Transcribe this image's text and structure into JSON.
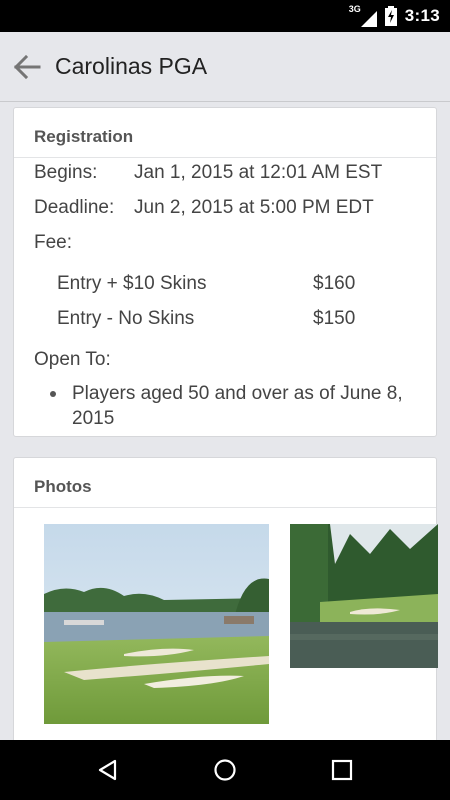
{
  "status_bar": {
    "network": "3G",
    "time": "3:13",
    "icons": [
      "signal-icon",
      "battery-charging-icon"
    ]
  },
  "app_bar": {
    "title": "Carolinas PGA",
    "back_icon": "arrow-back-icon"
  },
  "registration": {
    "header": "Registration",
    "begins_label": "Begins:",
    "begins_value": "Jan 1, 2015 at 12:01 AM EST",
    "deadline_label": "Deadline:",
    "deadline_value": "Jun 2, 2015 at 5:00 PM EDT",
    "fee_label": "Fee:",
    "fees": [
      {
        "name": "Entry + $10 Skins",
        "price": "$160"
      },
      {
        "name": "Entry - No Skins",
        "price": "$150"
      }
    ],
    "open_to_label": "Open To:",
    "eligibility": [
      "Players aged 50 and over as of June 8, 2015"
    ]
  },
  "photos": {
    "header": "Photos",
    "items": [
      "golf-course-lake-photo",
      "golf-course-pond-photo"
    ]
  },
  "nav_bar": {
    "buttons": [
      "back-triangle-icon",
      "home-circle-icon",
      "recents-square-icon"
    ]
  }
}
